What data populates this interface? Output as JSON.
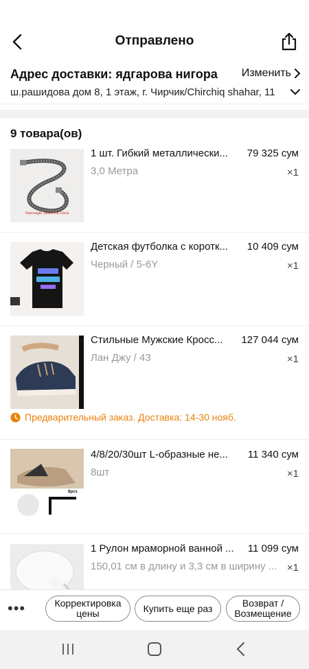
{
  "header": {
    "title": "Отправлено"
  },
  "address": {
    "title": "Адрес доставки: ядгарова нигора",
    "change_label": "Изменить",
    "line": "ш.рашидова дом 8, 1 этаж, г. Чирчик/Chirchiq shahar, 11"
  },
  "items_count": "9 товара(ов)",
  "items": [
    {
      "name": "1 шт. Гибкий металлически...",
      "price": "79 325 сум",
      "variant": "3,0 Метра",
      "qty": "×1",
      "thumb_caption": "Total length: 300cm/118.11inch"
    },
    {
      "name": "Детская футболка с коротк...",
      "price": "10 409 сум",
      "variant": "Черный / 5-6Y",
      "qty": "×1"
    },
    {
      "name": "Стильные Мужские Кросс...",
      "price": "127 044 сум",
      "variant": "Лан Джу / 43",
      "qty": "×1"
    },
    {
      "name": "4/8/20/30шт L-образные не...",
      "price": "11 340 сум",
      "variant": "8шт",
      "qty": "×1",
      "thumb_caption": "8pcs"
    },
    {
      "name": "1 Рулон мраморной ванной ...",
      "price": "11 099 сум",
      "variant": "150,01 см в длину и 3,3 см в ширину ...",
      "qty": "×1"
    }
  ],
  "preorder_note": "Предварительный заказ. Доставка: 14-30 нояб.",
  "bottom_actions": {
    "more": "•••",
    "price_adjust": "Корректировка цены",
    "buy_again": "Купить еще раз",
    "refund": "Возврат / Возмещение"
  },
  "colors": {
    "accent_orange": "#e8820c",
    "muted_text": "#999999",
    "divider": "#eeeeee"
  },
  "icons": [
    "back-arrow-icon",
    "share-icon",
    "chevron-right-icon",
    "chevron-down-icon",
    "clock-icon",
    "nav-recents-icon",
    "nav-home-icon",
    "nav-back-icon"
  ]
}
